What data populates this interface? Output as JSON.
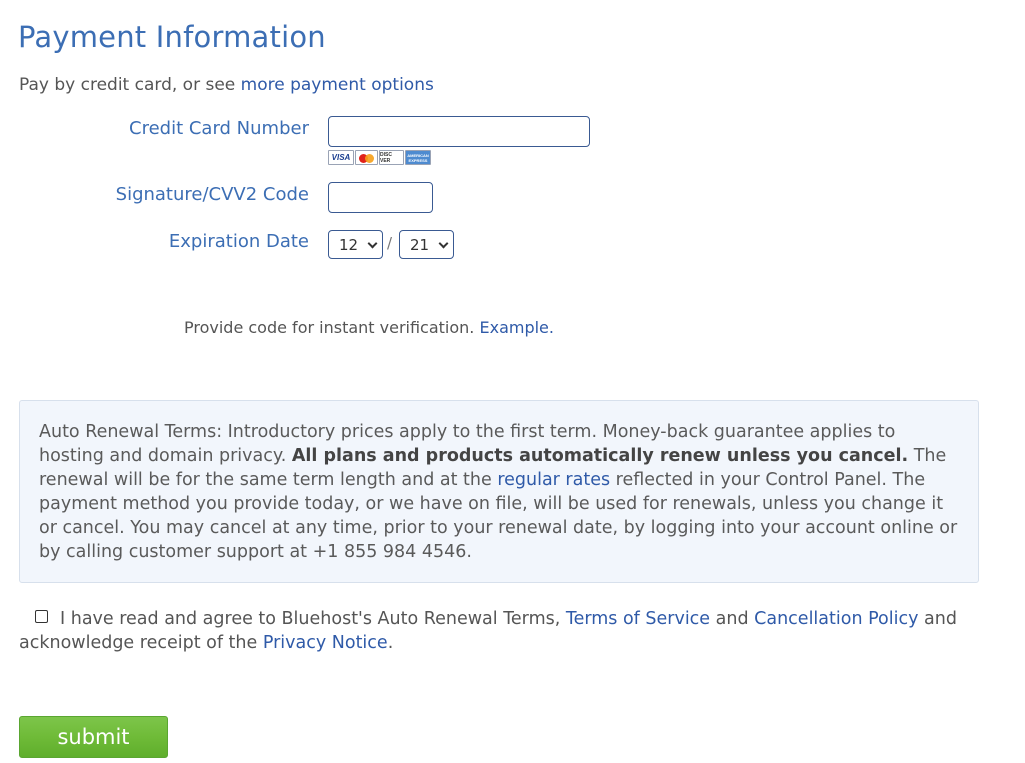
{
  "page": {
    "title": "Payment Information"
  },
  "intro": {
    "prefix": "Pay by credit card, or see ",
    "link": "more payment options"
  },
  "form": {
    "cc_label": "Credit Card Number",
    "cc_value": "",
    "cards": {
      "visa": "VISA",
      "discover": "DISC VER",
      "amex": "AMERICAN EXPRESS"
    },
    "cvv_label": "Signature/CVV2 Code",
    "cvv_value": "",
    "exp_label": "Expiration Date",
    "exp_month": "12",
    "exp_separator": "/",
    "exp_year": "21"
  },
  "verify": {
    "text": "Provide code for instant verification. ",
    "link": "Example."
  },
  "auto_renewal": {
    "lead": "Auto Renewal Terms: Introductory prices apply to the first term. Money-back guarantee applies to hosting and domain privacy. ",
    "bold": "All plans and products automatically renew unless you cancel.",
    "mid": " The renewal will be for the same term length and at the ",
    "link": "regular rates",
    "tail": " reflected in your Control Panel. The payment method you provide today, or we have on file, will be used for renewals, unless you change it or cancel. You may cancel at any time, prior to your renewal date, by logging into your account online or by calling customer support at +1 855 984 4546."
  },
  "agreement": {
    "part1": "I have read and agree to Bluehost's Auto Renewal Terms, ",
    "tos_link": "Terms of Service",
    "part2": " and ",
    "cancel_link": "Cancellation Policy",
    "part3": " and acknowledge receipt of the ",
    "privacy_link": "Privacy Notice",
    "part4": "."
  },
  "submit": {
    "label": "submit"
  },
  "colors": {
    "heading_blue": "#3c6eb4",
    "link_blue": "#2f5aa8",
    "button_green": "#6fbb38",
    "terms_bg": "#f2f6fc"
  }
}
